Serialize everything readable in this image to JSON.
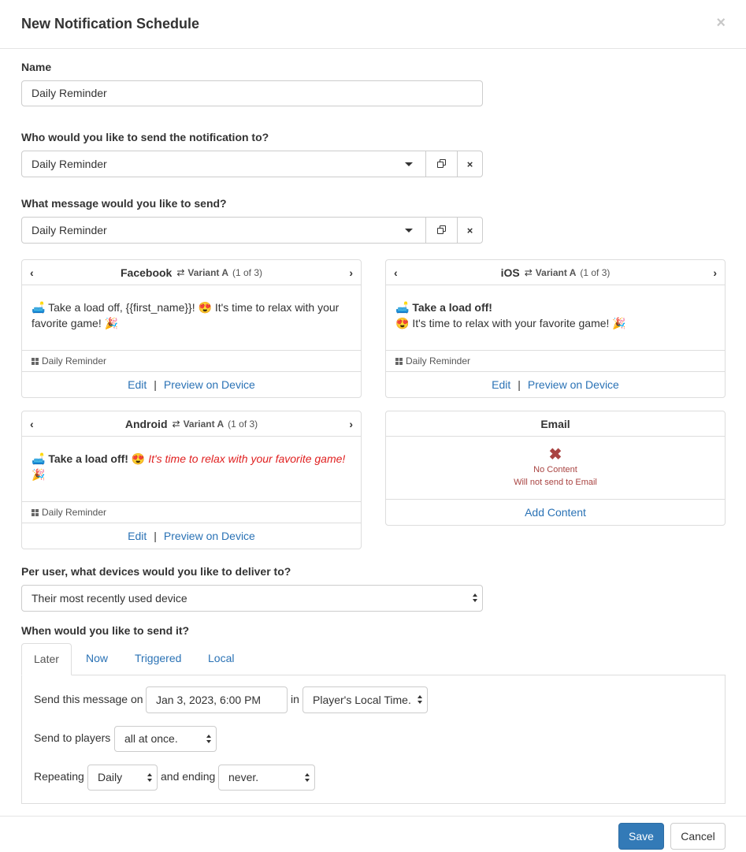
{
  "modal": {
    "title": "New Notification Schedule",
    "close_glyph": "×"
  },
  "name_field": {
    "label": "Name",
    "value": "Daily Reminder"
  },
  "audience": {
    "label": "Who would you like to send the notification to?",
    "value": "Daily Reminder",
    "clear_glyph": "×"
  },
  "message": {
    "label": "What message would you like to send?",
    "value": "Daily Reminder",
    "clear_glyph": "×"
  },
  "cards": {
    "facebook": {
      "platform": "Facebook",
      "variant": "Variant A",
      "count": "(1 of 3)",
      "emoji1": "🛋️",
      "text1": "Take a load off, {{first_name}}!",
      "emoji2": "😍",
      "text2": "It's time to relax with your favorite game!",
      "emoji3": "🎉",
      "footer": "Daily Reminder",
      "edit": "Edit",
      "sep": "|",
      "preview": "Preview on Device"
    },
    "ios": {
      "platform": "iOS",
      "variant": "Variant A",
      "count": "(1 of 3)",
      "emoji1": "🛋️",
      "bold": "Take a load off!",
      "emoji2": "😍",
      "text2": "It's time to relax with your favorite game!",
      "emoji3": "🎉",
      "footer": "Daily Reminder",
      "edit": "Edit",
      "sep": "|",
      "preview": "Preview on Device"
    },
    "android": {
      "platform": "Android",
      "variant": "Variant A",
      "count": "(1 of 3)",
      "emoji1": "🛋️",
      "bold": "Take a load off!",
      "emoji2": "😍",
      "italic": "It's time to relax with your favorite game!",
      "emoji3": "🎉",
      "footer": "Daily Reminder",
      "edit": "Edit",
      "sep": "|",
      "preview": "Preview on Device"
    },
    "email": {
      "platform": "Email",
      "x_glyph": "✖",
      "no_content": "No Content",
      "will_not": "Will not send to Email",
      "add": "Add Content"
    }
  },
  "devices": {
    "label": "Per user, what devices would you like to deliver to?",
    "value": "Their most recently used device"
  },
  "when": {
    "label": "When would you like to send it?",
    "tabs": [
      "Later",
      "Now",
      "Triggered",
      "Local"
    ],
    "send_on_label": "Send this message on",
    "date_value": "Jan 3, 2023, 6:00 PM",
    "in_label": "in",
    "timezone": "Player's Local Time.",
    "send_to_label": "Send to players",
    "send_to_value": "all at once.",
    "repeating_label": "Repeating",
    "repeating_value": "Daily",
    "ending_label": "and ending",
    "ending_value": "never."
  },
  "buttons": {
    "save": "Save",
    "cancel": "Cancel"
  }
}
